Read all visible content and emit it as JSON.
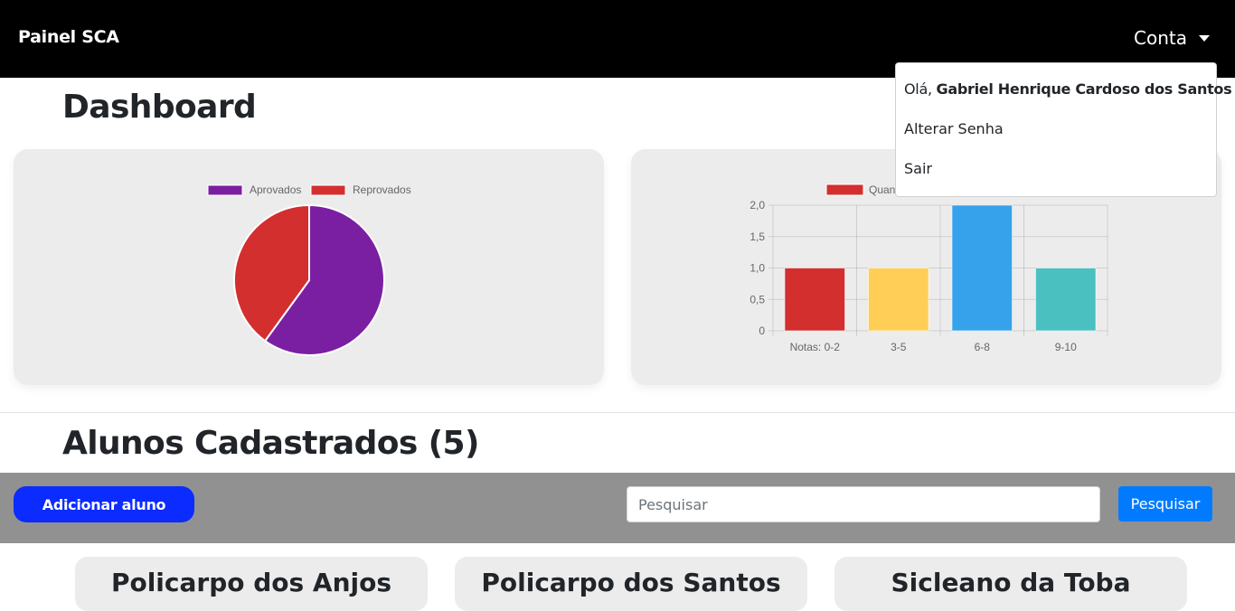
{
  "navbar": {
    "brand": "Painel SCA",
    "account_label": "Conta"
  },
  "account_menu": {
    "greeting_prefix": "Olá, ",
    "user_name": "Gabriel Henrique Cardoso dos Santos",
    "change_password": "Alterar Senha",
    "logout": "Sair"
  },
  "dashboard": {
    "title": "Dashboard"
  },
  "chart_data": [
    {
      "type": "pie",
      "legend": [
        "Aprovados",
        "Reprovados"
      ],
      "values": [
        3,
        2
      ],
      "colors": [
        "#7b1fa2",
        "#d32f2f"
      ],
      "legend_position": "top"
    },
    {
      "type": "bar",
      "legend": [
        "Quan"
      ],
      "categories": [
        "Notas: 0-2",
        "3-5",
        "6-8",
        "9-10"
      ],
      "values": [
        1,
        1,
        2,
        1
      ],
      "colors": [
        "#d32f2f",
        "#ffce56",
        "#36a2eb",
        "#4bc0c0"
      ],
      "ylim": [
        0,
        2
      ],
      "yticks": [
        "0",
        "0,5",
        "1,0",
        "1,5",
        "2,0"
      ],
      "grid": true,
      "legend_position": "top"
    }
  ],
  "students": {
    "title": "Alunos Cadastrados (5)",
    "add_button": "Adicionar aluno",
    "search_placeholder": "Pesquisar",
    "search_button": "Pesquisar",
    "cards": [
      "Policarpo dos Anjos",
      "Policarpo dos Santos",
      "Sicleano da Toba"
    ]
  }
}
